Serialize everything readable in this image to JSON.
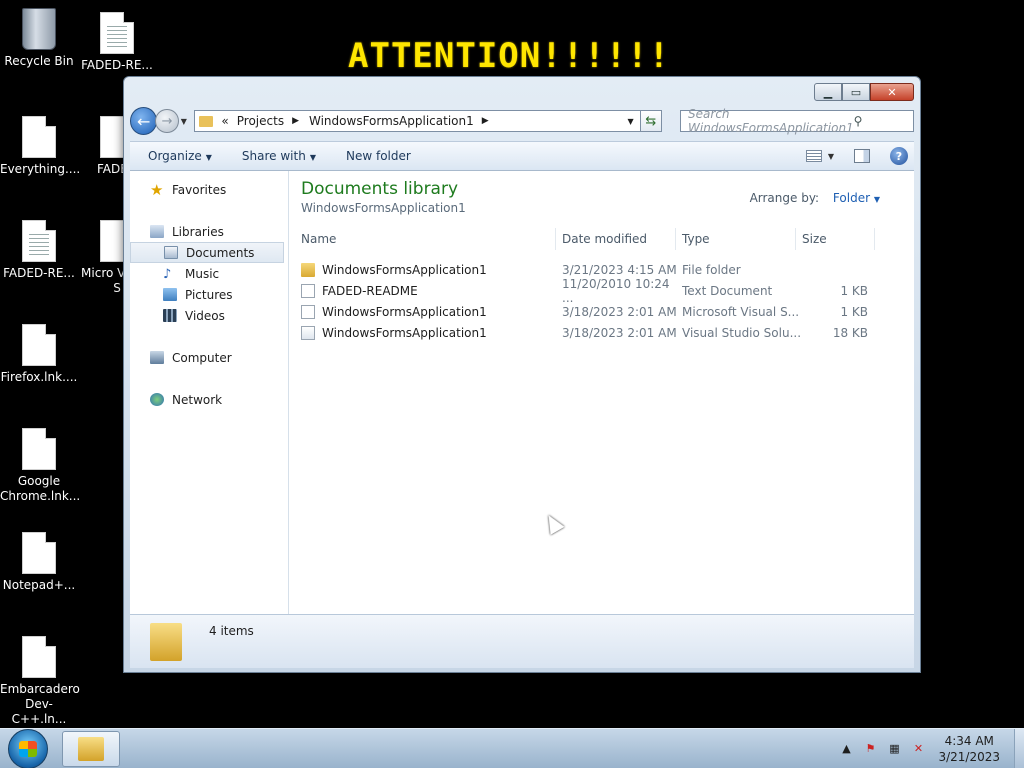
{
  "desktop": {
    "attention": "ATTENTION!!!!!!",
    "icons": [
      {
        "label": "Recycle Bin"
      },
      {
        "label": "FADED-RE..."
      },
      {
        "label": "Everything...."
      },
      {
        "label": "FADED"
      },
      {
        "label": "FADED-RE..."
      },
      {
        "label": "Micro Visual S"
      },
      {
        "label": "Firefox.lnk...."
      },
      {
        "label": "Google Chrome.lnk..."
      },
      {
        "label": "Notepad+..."
      },
      {
        "label": "Embarcadero Dev-C++.ln..."
      }
    ]
  },
  "window": {
    "address": {
      "overflow": "«",
      "crumb1": "Projects",
      "crumb2": "WindowsFormsApplication1"
    },
    "search_placeholder": "Search WindowsFormsApplication1",
    "commands": {
      "organize": "Organize",
      "share_with": "Share with",
      "new_folder": "New folder"
    },
    "nav": {
      "favorites": "Favorites",
      "libraries": "Libraries",
      "documents": "Documents",
      "music": "Music",
      "pictures": "Pictures",
      "videos": "Videos",
      "computer": "Computer",
      "network": "Network"
    },
    "library": {
      "title": "Documents library",
      "subtitle": "WindowsFormsApplication1"
    },
    "arrange": {
      "label": "Arrange by:",
      "value": "Folder"
    },
    "columns": {
      "name": "Name",
      "date": "Date modified",
      "type": "Type",
      "size": "Size"
    },
    "files": [
      {
        "name": "WindowsFormsApplication1",
        "date": "3/21/2023 4:15 AM",
        "type": "File folder",
        "size": ""
      },
      {
        "name": "FADED-README",
        "date": "11/20/2010 10:24 ...",
        "type": "Text Document",
        "size": "1 KB"
      },
      {
        "name": "WindowsFormsApplication1",
        "date": "3/18/2023 2:01 AM",
        "type": "Microsoft Visual S...",
        "size": "1 KB"
      },
      {
        "name": "WindowsFormsApplication1",
        "date": "3/18/2023 2:01 AM",
        "type": "Visual Studio Solu...",
        "size": "18 KB"
      }
    ],
    "status": {
      "count": "4 items"
    }
  },
  "taskbar": {
    "time": "4:34 AM",
    "date": "3/21/2023"
  }
}
